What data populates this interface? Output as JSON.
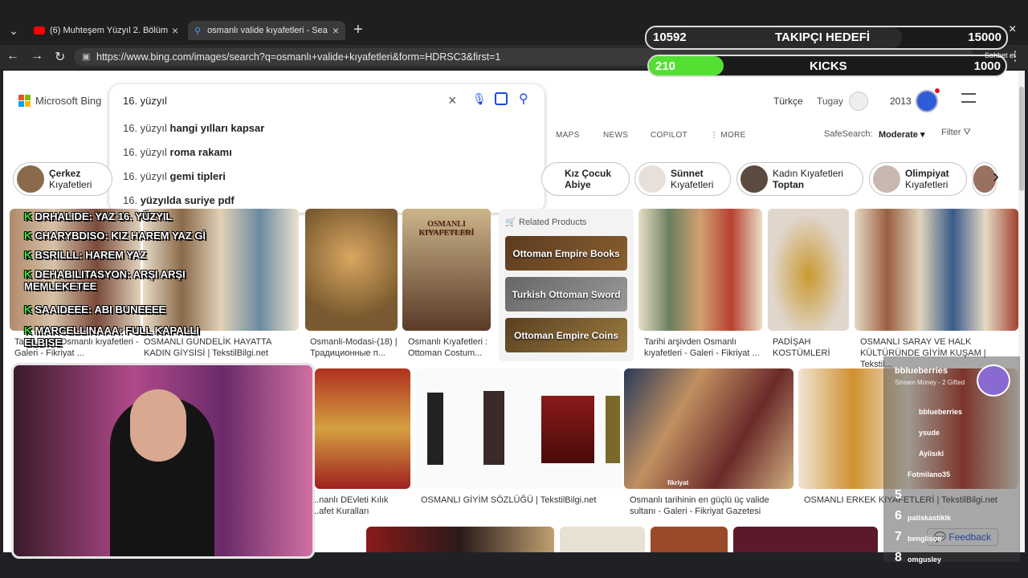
{
  "tabs": [
    {
      "label": "(6) Muhteşem Yüzyıl 2. Bölüm (HD)"
    },
    {
      "label": "osmanlı valide kıyafetleri - Search"
    }
  ],
  "url": "https://www.bing.com/images/search?q=osmanlı+valide+kıyafetleri&form=HDRSC3&first=1",
  "brand": "Microsoft Bing",
  "search": {
    "value": "16. yüzyıl",
    "suggestions": [
      {
        "pre": "16. yüzyıl ",
        "bold": "hangi yılları kapsar"
      },
      {
        "pre": "16. yüzyıl ",
        "bold": "roma rakamı"
      },
      {
        "pre": "16. yüzyıl ",
        "bold": "gemi tipleri"
      },
      {
        "pre": "16. ",
        "bold": "yüzyılda suriye pdf"
      }
    ]
  },
  "header": {
    "lang": "Türkçe",
    "user": "Tugay",
    "points": "2013"
  },
  "nav": {
    "maps": "MAPS",
    "news": "NEWS",
    "copilot": "COPILOT",
    "more": "MORE",
    "safesearch_label": "SafeSearch:",
    "safesearch_value": "Moderate",
    "filter": "Filter"
  },
  "chips": [
    {
      "l1": "Çerkez",
      "l2": "Kıyafetleri"
    },
    {
      "l1": "Kız Çocuk",
      "l2": "Abiye"
    },
    {
      "l1": "Sünnet",
      "l2": "Kıyafetleri"
    },
    {
      "l1": "Kadın Kıyafetleri",
      "l2": "Toptan"
    },
    {
      "l1": "Olimpiyat",
      "l2": "Kıyafetleri"
    }
  ],
  "related": {
    "title": "Related Products",
    "items": [
      "Ottoman Empire Books",
      "Turkish Ottoman Sword",
      "Ottoman Empire Coins"
    ]
  },
  "captions": {
    "c1": "Tarihi ... en Osmanlı kıyafetleri - Galeri - Fikriyat ...",
    "c2": "OSMANLI GÜNDELİK HAYATTA KADIN GİYSİSİ | TekstilBilgi.net",
    "c3": "Osmanli-Modasi-(18) | Традиционные п...",
    "c4": "Osmanlı Kıyafetleri : Ottoman Costum...",
    "c5": "Tarihi arşivden Osmanlı kıyafetleri - Galeri - Fikriyat ...",
    "c6": "PADİŞAH KOSTÜMLERİ",
    "c7": "OSMANLI SARAY VE HALK KÜLTÜRÜNDE GİYİM KUŞAM | Tekstil...",
    "c8": "...nanlı DEvleti Kılık ...afet Kuralları",
    "c9": "OSMANLI GİYİM SÖZLÜĞÜ | TekstilBilgi.net",
    "c10": "Osmanlı tarihinin en güçlü üç valide sultanı - Galeri - Fikriyat Gazetesi",
    "c11": "OSMANLI ERKEK KIYAFETLERİ | TekstilBilgi.net"
  },
  "book_title": "OSMANLI KIYAFETLERİ",
  "image_text": {
    "watermark": "fikriyat",
    "book_subtitle": "OTTOMAN COSTUMES"
  },
  "chat": [
    {
      "name": "DRHALIDE",
      "msg": "YAZ 16. YÜZYIL"
    },
    {
      "name": "CHARYBDISO",
      "msg": "KIZ HAREM YAZ Gİ"
    },
    {
      "name": "BSRILLL",
      "msg": "HAREM YAZ"
    },
    {
      "name": "DEHABILITASYON",
      "msg": "ARŞI ARŞI MEMLEKETEE"
    },
    {
      "name": "SAAIDEEE",
      "msg": "ABI BUNEEEE"
    },
    {
      "name": "MARCELLINAAA",
      "msg": "FULL KAPALLI ELBISE"
    }
  ],
  "goal": {
    "followers": "10592",
    "label": "TAKIPÇI HEDEFİ",
    "target": "15000",
    "kicks": "210",
    "kicks_label": "KICKS",
    "kicks_target": "1000",
    "followers_fill": 0.71,
    "kicks_fill": 0.21
  },
  "leaderboard": {
    "title": "bblueberries",
    "subtitle": "Stream Money - 2 Gifted",
    "rows": [
      "bblueberries",
      "ysude",
      "Ayiisıki",
      "Fotmilano35",
      "",
      "patiskastikik",
      "benglisoo",
      "omgusley"
    ],
    "ranks": [
      "5",
      "6",
      "7",
      "8"
    ]
  },
  "feedback": "Feedback",
  "corner_text": "Sohbet et"
}
